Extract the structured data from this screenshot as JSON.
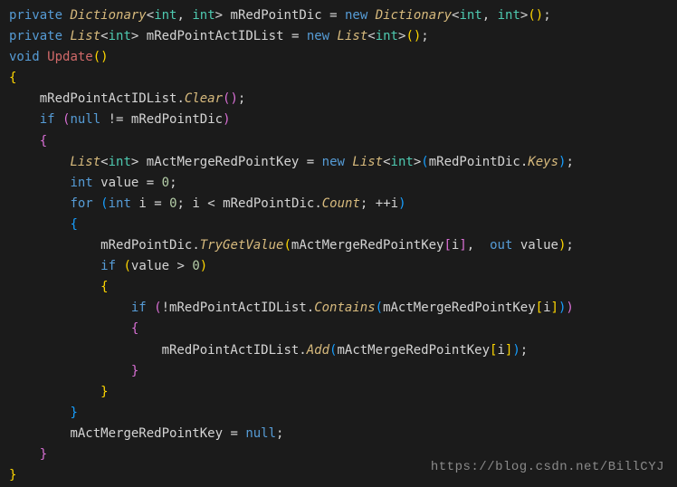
{
  "code": {
    "line1": {
      "kw_private": "private",
      "type_dict": "Dictionary",
      "type_int": "int",
      "var": "mRedPointDic",
      "kw_new": "new"
    },
    "line2": {
      "kw_private": "private",
      "type_list": "List",
      "type_int": "int",
      "var": "mRedPointActIDList",
      "kw_new": "new"
    },
    "line3": {
      "kw_void": "void",
      "method": "Update"
    },
    "line5": {
      "var": "mRedPointActIDList",
      "method": "Clear"
    },
    "line6": {
      "kw_if": "if",
      "kw_null": "null",
      "var": "mRedPointDic"
    },
    "line8": {
      "type_list": "List",
      "type_int": "int",
      "var": "mActMergeRedPointKey",
      "kw_new": "new",
      "arg_var": "mRedPointDic",
      "prop": "Keys"
    },
    "line9": {
      "type_int": "int",
      "var": "value",
      "val": "0"
    },
    "line10": {
      "kw_for": "for",
      "type_int": "int",
      "var_i": "i",
      "zero": "0",
      "dic": "mRedPointDic",
      "prop": "Count"
    },
    "line12": {
      "dic": "mRedPointDic",
      "method": "TryGetValue",
      "arg1": "mActMergeRedPointKey",
      "idx": "i",
      "kw_out": "out",
      "arg2": "value"
    },
    "line13": {
      "kw_if": "if",
      "var": "value",
      "zero": "0"
    },
    "line15": {
      "kw_if": "if",
      "list": "mRedPointActIDList",
      "method": "Contains",
      "arg": "mActMergeRedPointKey",
      "idx": "i"
    },
    "line17": {
      "list": "mRedPointActIDList",
      "method": "Add",
      "arg": "mActMergeRedPointKey",
      "idx": "i"
    },
    "line21": {
      "var": "mActMergeRedPointKey",
      "kw_null": "null"
    }
  },
  "watermark": "https://blog.csdn.net/BillCYJ"
}
